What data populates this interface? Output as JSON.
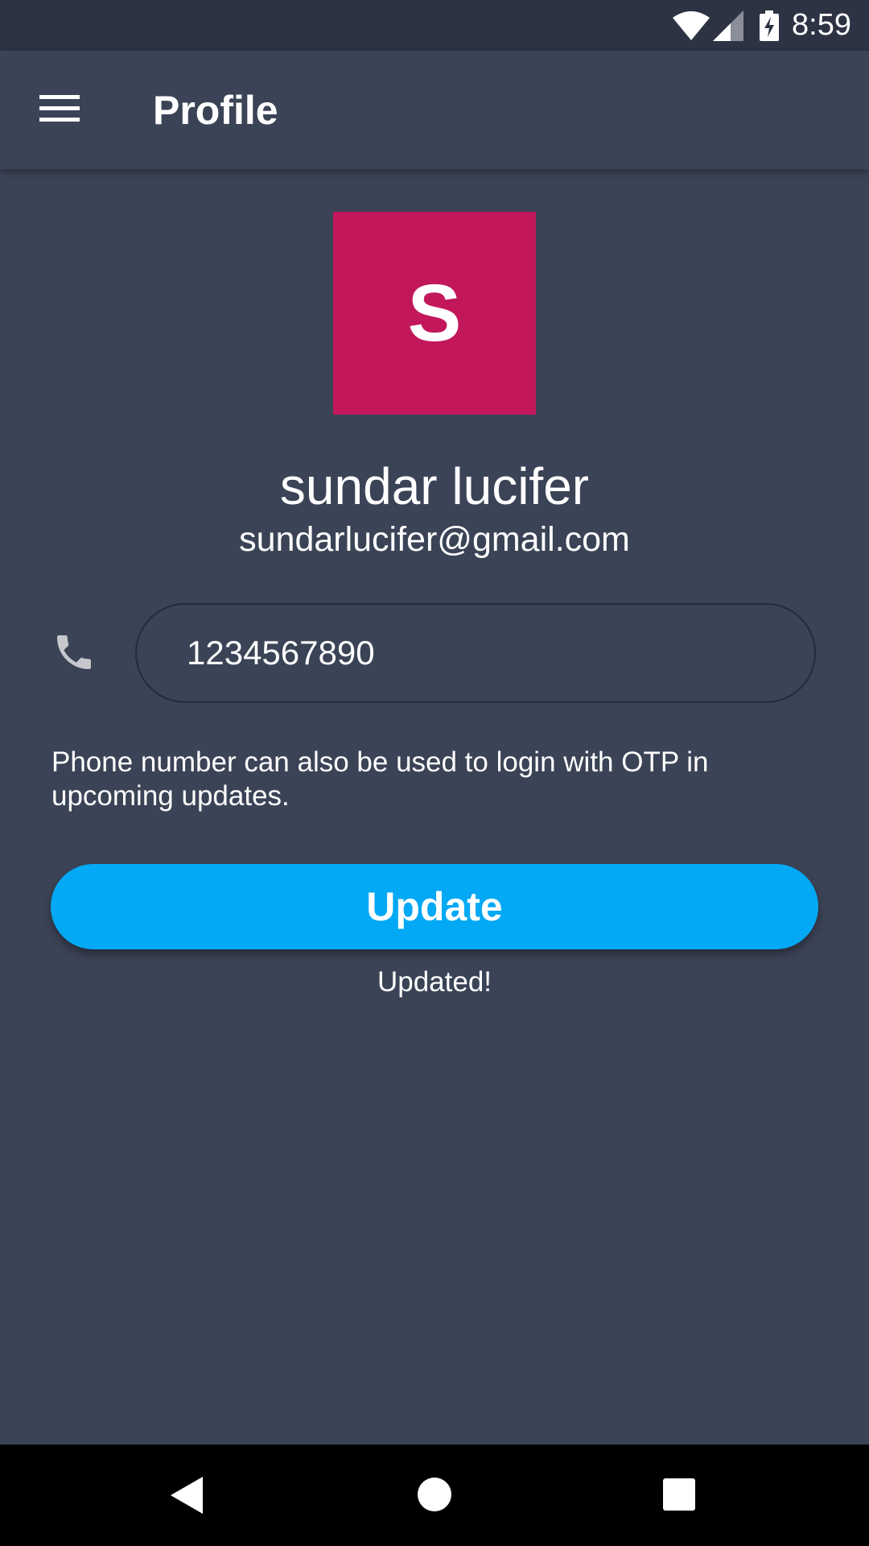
{
  "status_bar": {
    "time": "8:59",
    "icons": [
      "wifi-icon",
      "signal-icon",
      "battery-charging-icon"
    ]
  },
  "app_bar": {
    "title": "Profile",
    "menu_icon": "menu-icon"
  },
  "profile": {
    "avatar_letter": "S",
    "avatar_color": "#c2185b",
    "name": "sundar lucifer",
    "email": "sundarlucifer@gmail.com"
  },
  "phone": {
    "icon": "phone-icon",
    "value": "1234567890",
    "helper_text": "Phone number can also be used to login with OTP in upcoming updates."
  },
  "actions": {
    "update_label": "Update",
    "status_message": "Updated!"
  },
  "nav_bar": {
    "buttons": [
      "back-icon",
      "home-icon",
      "recents-icon"
    ]
  },
  "colors": {
    "background": "#3b4356",
    "status_bar": "#2d3343",
    "accent": "#03a9f4",
    "avatar": "#c2185b"
  }
}
